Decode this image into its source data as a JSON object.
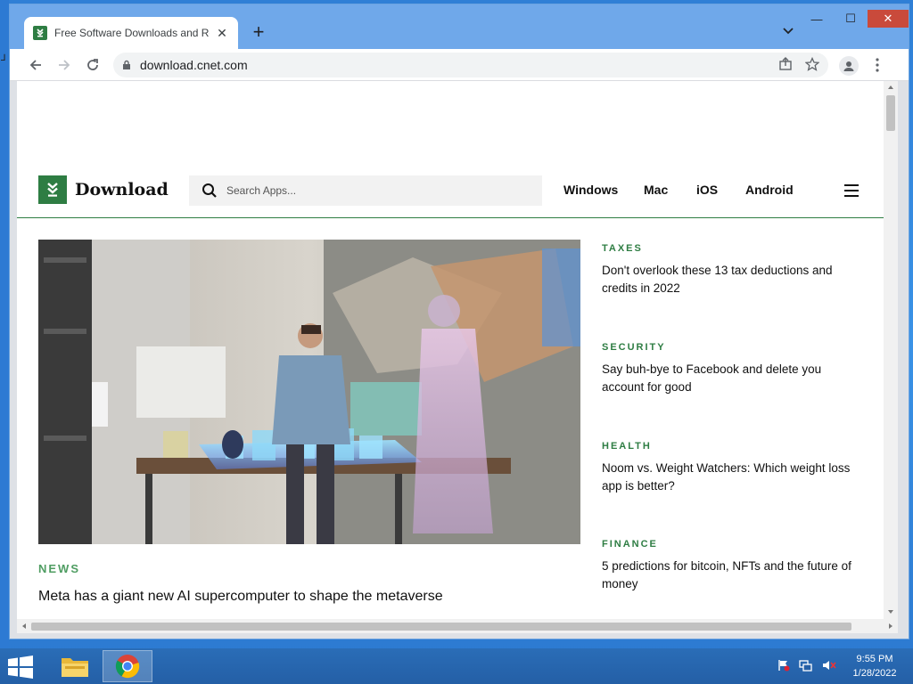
{
  "browser": {
    "tab_title": "Free Software Downloads and Re",
    "tab_close": "✕",
    "new_tab": "+",
    "url": "download.cnet.com",
    "window_controls": {
      "minimize": "—",
      "maximize": "☐",
      "close": "✕"
    }
  },
  "site": {
    "logo_text": "Download",
    "search_placeholder": "Search Apps...",
    "platforms": [
      "Windows",
      "Mac",
      "iOS",
      "Android"
    ]
  },
  "hero": {
    "category": "NEWS",
    "title": "Meta has a giant new AI supercomputer to shape the metaverse"
  },
  "side_articles": [
    {
      "category": "TAXES",
      "title": "Don't overlook these 13 tax deductions and credits in 2022"
    },
    {
      "category": "SECURITY",
      "title": "Say buh-bye to Facebook and delete you account for good"
    },
    {
      "category": "HEALTH",
      "title": "Noom vs. Weight Watchers: Which weight loss app is better?"
    },
    {
      "category": "FINANCE",
      "title": "5 predictions for bitcoin, NFTs and the future of money"
    }
  ],
  "taskbar": {
    "time": "9:55 PM",
    "date": "1/28/2022"
  },
  "colors": {
    "brand_green": "#2e7d43",
    "category_green": "#4f9d62",
    "close_red": "#c94a3b",
    "titlebar_blue": "#6fa8ea"
  }
}
